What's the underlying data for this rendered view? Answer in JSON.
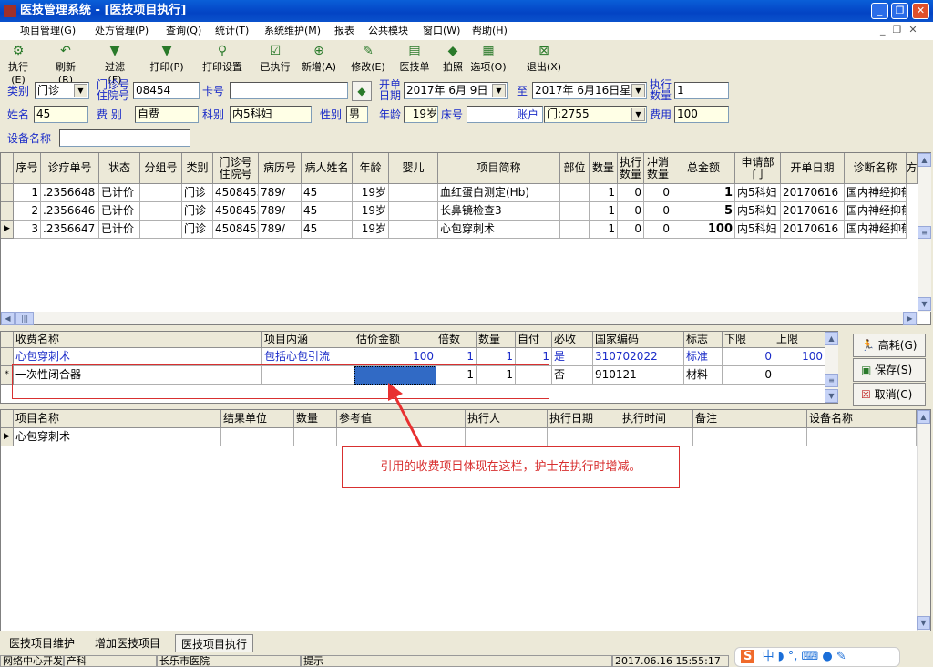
{
  "window": {
    "title": "医技管理系统 - [医技项目执行]"
  },
  "menu": [
    "项目管理(G)",
    "处方管理(P)",
    "查询(Q)",
    "统计(T)",
    "系统维护(M)",
    "报表",
    "公共模块",
    "窗口(W)",
    "帮助(H)"
  ],
  "toolbar": [
    {
      "label": "执行(E)",
      "icon": "gear-icon"
    },
    {
      "label": "刷新(R)",
      "icon": "refresh-icon"
    },
    {
      "label": "过滤(F)",
      "icon": "filter-icon"
    },
    {
      "label": "打印(P)",
      "icon": "filter-icon"
    },
    {
      "label": "打印设置",
      "icon": "print-setup-icon"
    },
    {
      "label": "已执行",
      "icon": "check-icon"
    },
    {
      "label": "新增(A)",
      "icon": "add-icon"
    },
    {
      "label": "修改(E)",
      "icon": "edit-icon"
    },
    {
      "label": "医技单",
      "icon": "clipboard-icon"
    },
    {
      "label": "拍照",
      "icon": "camera-icon"
    },
    {
      "label": "选项(O)",
      "icon": "options-icon"
    },
    {
      "label": "退出(X)",
      "icon": "exit-icon"
    }
  ],
  "form": {
    "category_label": "类别",
    "category": "门诊",
    "outpatient_label1": "门诊号",
    "outpatient_label2": "住院号",
    "outpatient_no": "08454",
    "card_label": "卡号",
    "card_no": "",
    "open_date_label1": "开单",
    "open_date_label2": "日期",
    "date_from": "2017年 6月 9日",
    "to_label": "至",
    "date_to": "2017年 6月16日星",
    "exec_qty_label1": "执行",
    "exec_qty_label2": "数量",
    "exec_qty": "1",
    "name_label": "姓名",
    "name": "45",
    "fee_type_label": "费  别",
    "fee_type": "自费",
    "dept_label": "科别",
    "dept": "内5科妇",
    "sex_label": "性别",
    "sex": "男",
    "age_label": "年龄",
    "age": "19岁",
    "bed_label": "床号",
    "bed": "",
    "account_label": "账户",
    "account": "门:2755",
    "fee_label": "费用",
    "fee": "100",
    "device_label": "设备名称",
    "device": ""
  },
  "main_grid": {
    "headers": [
      "序号",
      "诊疗单号",
      "状态",
      "分组号",
      "类别",
      "门诊号\n住院号",
      "病历号",
      "病人姓名",
      "年龄",
      "婴儿",
      "项目简称",
      "部位",
      "数量",
      "执行\n数量",
      "冲消\n数量",
      "总金额",
      "申请部\n门",
      "开单日期",
      "诊断名称",
      "方"
    ],
    "rows": [
      [
        "1",
        ".2356648",
        "已计价",
        "",
        "门诊",
        "4508455",
        "789/",
        "45",
        "19岁",
        "",
        "血红蛋白测定(Hb)",
        "",
        "1",
        "0",
        "0",
        "1",
        "内5科妇",
        "20170616",
        "国内神经抑郁"
      ],
      [
        "2",
        ".2356646",
        "已计价",
        "",
        "门诊",
        "4508455",
        "789/",
        "45",
        "19岁",
        "",
        "长鼻镜检查3",
        "",
        "1",
        "0",
        "0",
        "5",
        "内5科妇",
        "20170616",
        "国内神经抑郁"
      ],
      [
        "3",
        ".2356647",
        "已计价",
        "",
        "门诊",
        "4508455",
        "789/",
        "45",
        "19岁",
        "",
        "心包穿刺术",
        "",
        "1",
        "0",
        "0",
        "100",
        "内5科妇",
        "20170616",
        "国内神经抑郁"
      ]
    ]
  },
  "fee_grid": {
    "headers": [
      "收费名称",
      "项目内涵",
      "估价金额",
      "倍数",
      "数量",
      "自付",
      "必收",
      "国家编码",
      "标志",
      "下限",
      "上限"
    ],
    "rows": [
      [
        "心包穿刺术",
        "包括心包引流",
        "100",
        "1",
        "1",
        "1",
        "是",
        "310702022",
        "标准",
        "0",
        "100"
      ],
      [
        "一次性闭合器",
        "",
        "",
        "1",
        "1",
        "",
        "否",
        "910121",
        "材料",
        "0",
        ""
      ]
    ]
  },
  "side_buttons": [
    "高耗(G)",
    "保存(S)",
    "取消(C)"
  ],
  "result_grid": {
    "headers": [
      "项目名称",
      "结果单位",
      "数量",
      "参考值",
      "执行人",
      "执行日期",
      "执行时间",
      "备注",
      "设备名称"
    ],
    "rows": [
      [
        "心包穿刺术",
        "",
        "",
        "",
        "",
        "",
        "",
        "",
        ""
      ]
    ]
  },
  "annotation": "引用的收费项目体现在这栏，护士在执行时增减。",
  "tabs": [
    "医技项目维护",
    "增加医技项目",
    "医技项目执行"
  ],
  "status": [
    "网络中心开发",
    "产科",
    "长乐市医院",
    "提示",
    "2017.06.16 15:55:17"
  ],
  "ime": "中"
}
